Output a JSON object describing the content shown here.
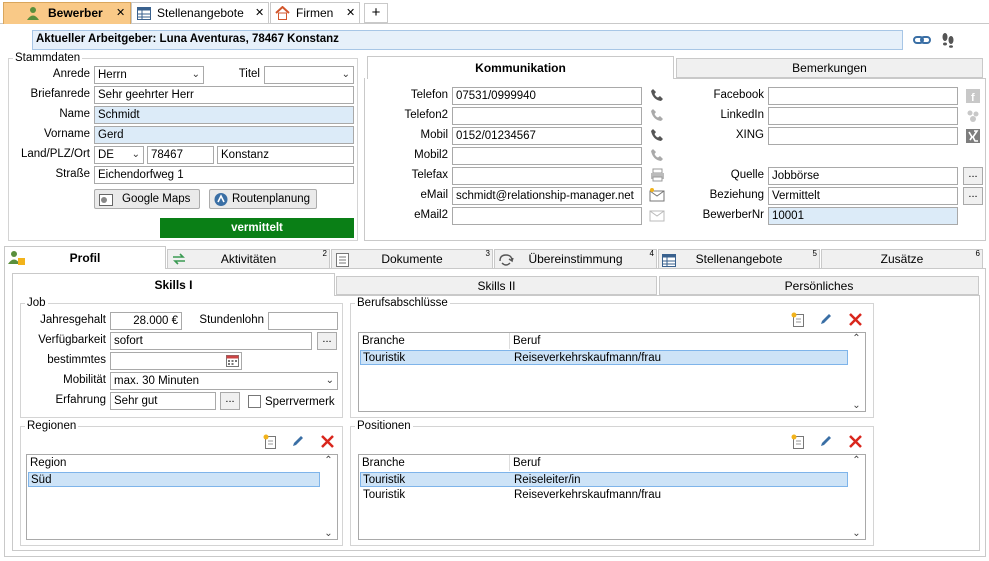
{
  "doc_tabs": [
    {
      "label": "Bewerber"
    },
    {
      "label": "Stellenangebote"
    },
    {
      "label": "Firmen"
    }
  ],
  "new_tab": "+",
  "close_glyph": "✕",
  "current_employer": "Aktueller Arbeitgeber: Luna Aventuras, 78467 Konstanz",
  "stammdaten": {
    "title": "Stammdaten",
    "anrede_label": "Anrede",
    "anrede_value": "Herrn",
    "titel_label": "Titel",
    "titel_value": "",
    "briefanrede_label": "Briefanrede",
    "briefanrede_value": "Sehr geehrter Herr",
    "name_label": "Name",
    "name_value": "Schmidt",
    "vorname_label": "Vorname",
    "vorname_value": "Gerd",
    "land_label": "Land/PLZ/Ort",
    "land_value": "DE",
    "plz_value": "78467",
    "ort_value": "Konstanz",
    "strasse_label": "Straße",
    "strasse_value": "Eichendorfweg 1",
    "google_maps": "Google Maps",
    "routenplanung": "Routenplanung",
    "status": "vermittelt",
    "status_color": "#0a7f16"
  },
  "comm_tabs": {
    "kommunikation": "Kommunikation",
    "bemerkungen": "Bemerkungen"
  },
  "comm": {
    "telefon_label": "Telefon",
    "telefon_value": "07531/0999940",
    "telefon2_label": "Telefon2",
    "telefon2_value": "",
    "mobil_label": "Mobil",
    "mobil_value": "0152/01234567",
    "mobil2_label": "Mobil2",
    "mobil2_value": "",
    "telefax_label": "Telefax",
    "telefax_value": "",
    "email_label": "eMail",
    "email_value": "schmidt@relationship-manager.net",
    "email2_label": "eMail2",
    "email2_value": "",
    "facebook_label": "Facebook",
    "facebook_value": "",
    "linkedin_label": "LinkedIn",
    "linkedin_value": "",
    "xing_label": "XING",
    "xing_value": "",
    "quelle_label": "Quelle",
    "quelle_value": "Jobbörse",
    "beziehung_label": "Beziehung",
    "beziehung_value": "Vermittelt",
    "bewerbernr_label": "BewerberNr",
    "bewerbernr_value": "10001",
    "dots": "..."
  },
  "main_tabs": [
    {
      "label": "Profil",
      "num": ""
    },
    {
      "label": "Aktivitäten",
      "num": "2"
    },
    {
      "label": "Dokumente",
      "num": "3"
    },
    {
      "label": "Übereinstimmung",
      "num": "4"
    },
    {
      "label": "Stellenangebote",
      "num": "5"
    },
    {
      "label": "Zusätze",
      "num": "6"
    }
  ],
  "sub_tabs": [
    {
      "label": "Skills I"
    },
    {
      "label": "Skills II"
    },
    {
      "label": "Persönliches"
    }
  ],
  "job": {
    "title": "Job",
    "jahresgehalt_label": "Jahresgehalt",
    "jahresgehalt_value": "28.000 €",
    "stundenlohn_label": "Stundenlohn",
    "stundenlohn_value": "",
    "verfuegbarkeit_label": "Verfügbarkeit",
    "verfuegbarkeit_value": "sofort",
    "bestimmtes_label": "bestimmtes",
    "bestimmtes_value": "",
    "mobilitaet_label": "Mobilität",
    "mobilitaet_value": "max. 30 Minuten",
    "erfahrung_label": "Erfahrung",
    "erfahrung_value": "Sehr gut",
    "sperrvermerk_label": "Sperrvermerk",
    "dots": "..."
  },
  "regionen": {
    "title": "Regionen",
    "col": "Region",
    "rows": [
      "Süd"
    ]
  },
  "berufsabschluesse": {
    "title": "Berufsabschlüsse",
    "cols": [
      "Branche",
      "Beruf"
    ],
    "rows": [
      {
        "branche": "Touristik",
        "beruf": "Reiseverkehrskaufmann/frau"
      }
    ]
  },
  "positionen": {
    "title": "Positionen",
    "cols": [
      "Branche",
      "Beruf"
    ],
    "rows": [
      {
        "branche": "Touristik",
        "beruf": "Reiseleiter/in"
      },
      {
        "branche": "Touristik",
        "beruf": "Reiseverkehrskaufmann/frau"
      }
    ]
  },
  "colors": {
    "active_tab": "#f9c987",
    "accent_blue": "#dcebf8",
    "selection": "#cde3f7",
    "delete_red": "#d9261c"
  }
}
